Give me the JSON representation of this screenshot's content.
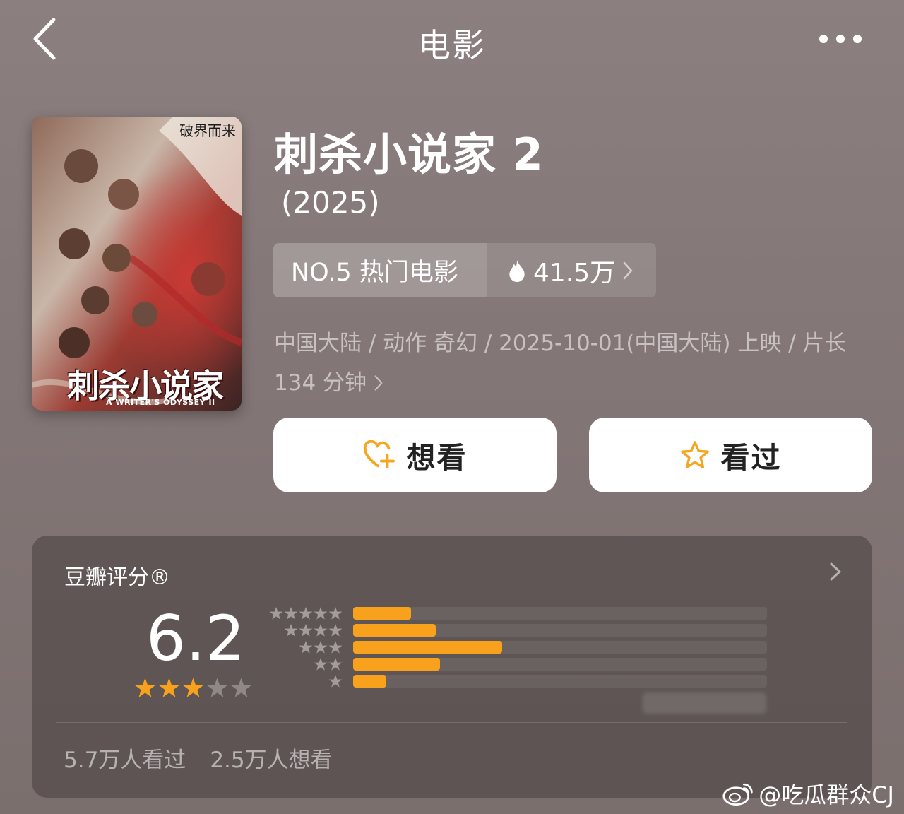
{
  "header": {
    "title": "电影",
    "back_icon": "chevron-left-icon",
    "more_icon": "more-horizontal-icon"
  },
  "movie": {
    "poster": {
      "brand_text": "破界而来",
      "title_text": "刺杀小说家",
      "subtitle_text": "A WRITER'S ODYSSEY II"
    },
    "title": "刺杀小说家 2",
    "year": "(2025)",
    "rank": {
      "label": "NO.5 热门电影",
      "heat": "41.5万",
      "heat_icon": "flame-icon"
    },
    "meta": {
      "line1": "中国大陆 / 动作 奇幻 / 2025-10-01(中国大陆) 上映 / 片长",
      "line2": "134 分钟"
    }
  },
  "actions": {
    "want_label": "想看",
    "seen_label": "看过",
    "accent_color": "#f5a623"
  },
  "rating": {
    "label": "豆瓣评分®",
    "score": "6.2",
    "stars_filled": 3,
    "stars_total": 5,
    "distribution": [
      {
        "stars": 5,
        "fraction": 0.14
      },
      {
        "stars": 4,
        "fraction": 0.2
      },
      {
        "stars": 3,
        "fraction": 0.36
      },
      {
        "stars": 2,
        "fraction": 0.21
      },
      {
        "stars": 1,
        "fraction": 0.08
      }
    ],
    "seen_count": "5.7万人看过",
    "want_count": "2.5万人想看",
    "bar_color": "#f8a11c"
  },
  "watermark": {
    "text": "@吃瓜群众CJ",
    "icon": "weibo-icon"
  }
}
